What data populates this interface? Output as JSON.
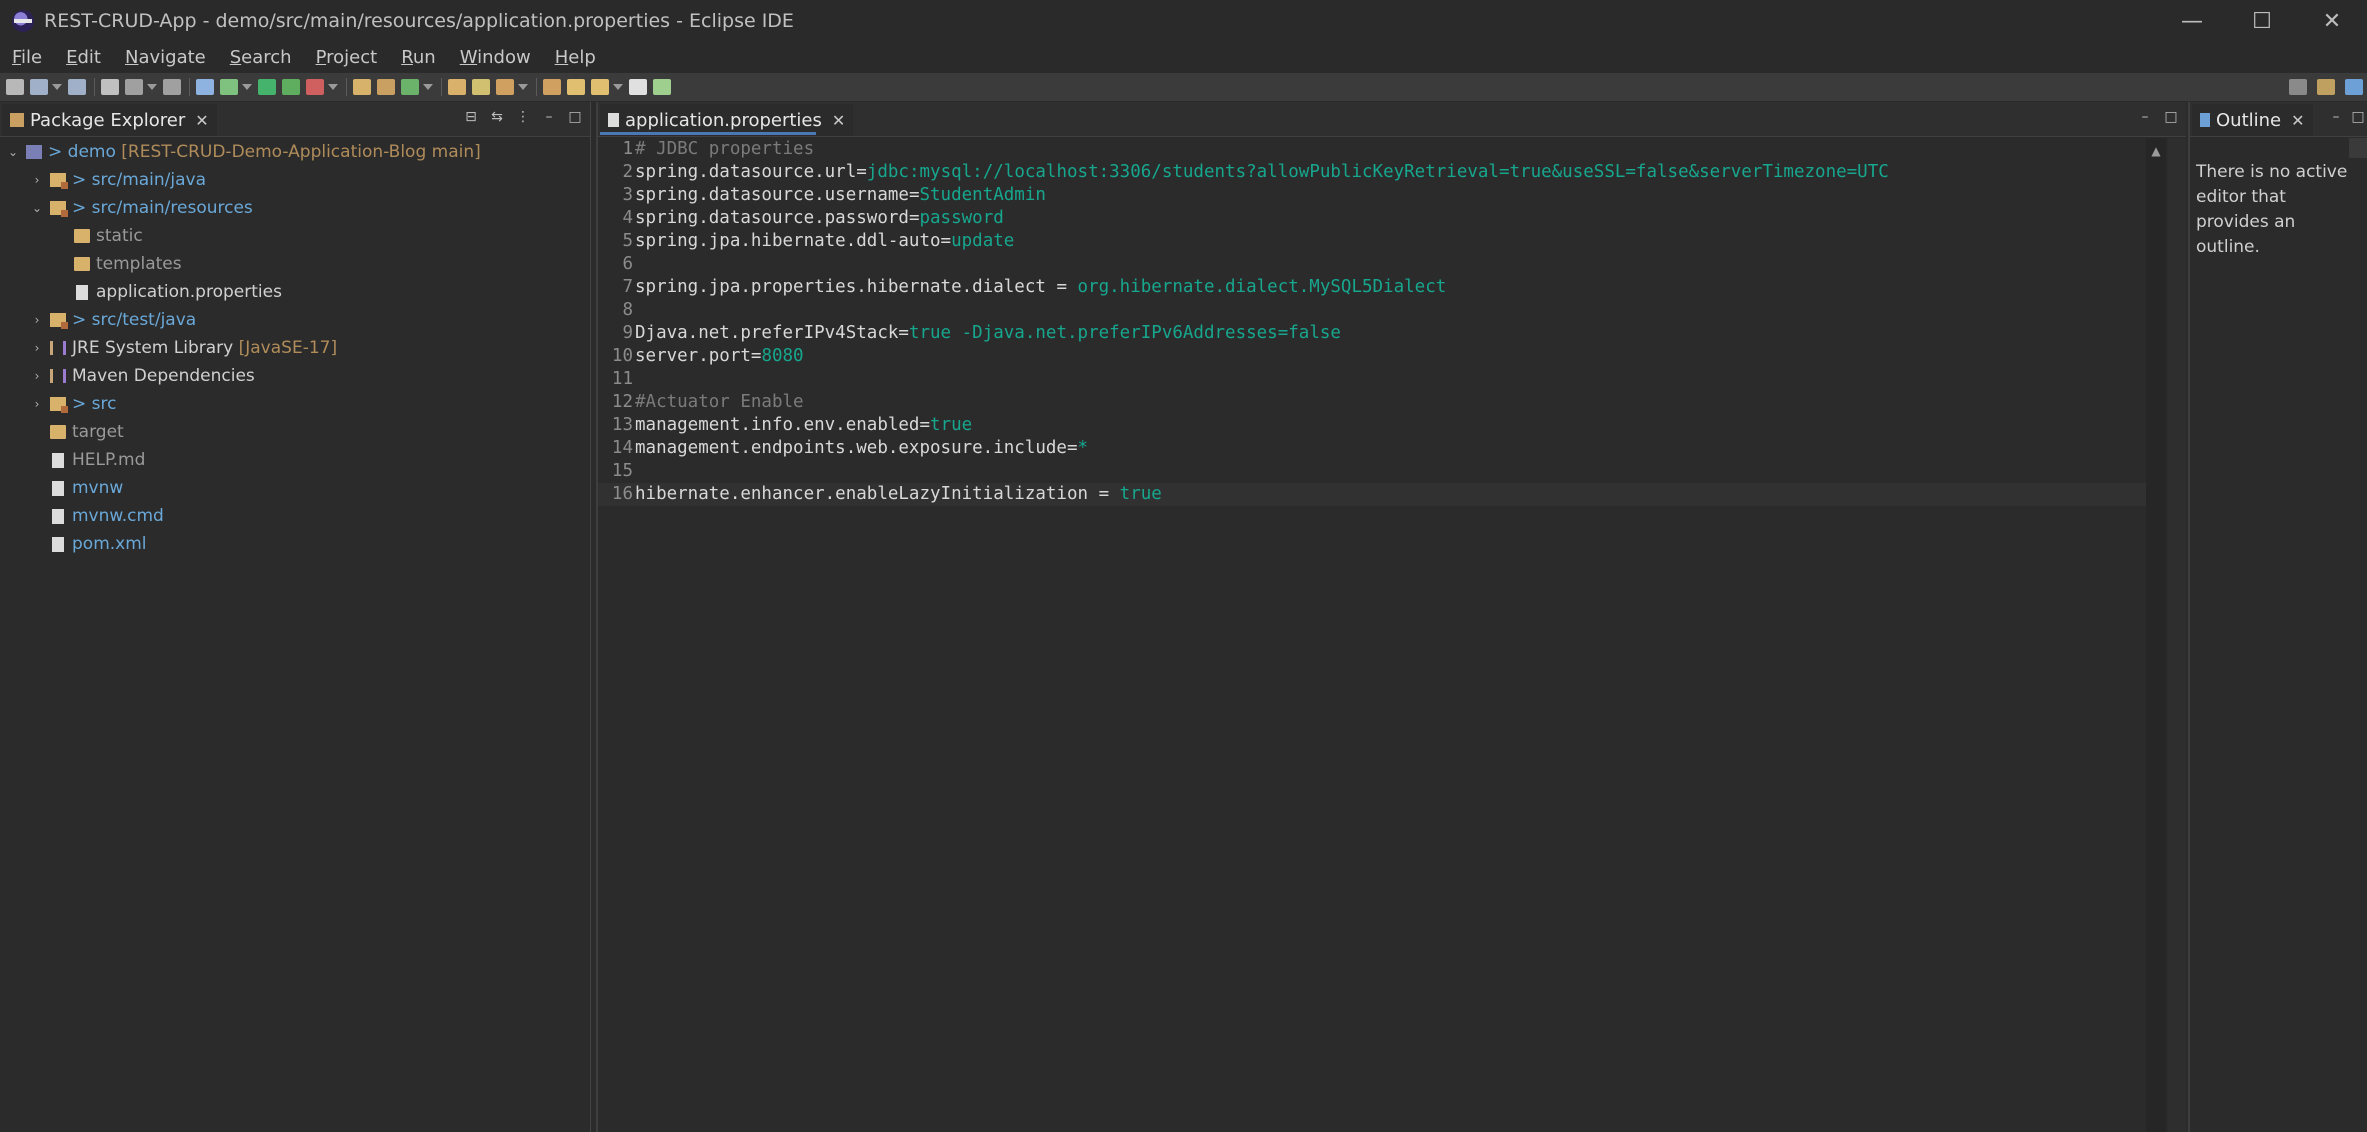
{
  "window": {
    "title": "REST-CRUD-App - demo/src/main/resources/application.properties - Eclipse IDE",
    "controls": {
      "minimize": "—",
      "maximize": "☐",
      "close": "✕"
    }
  },
  "menu": [
    "File",
    "Edit",
    "Navigate",
    "Search",
    "Project",
    "Run",
    "Window",
    "Help"
  ],
  "toolbar": {
    "icons": [
      {
        "name": "new-icon",
        "color": "#b8b8b8"
      },
      {
        "name": "save-icon",
        "color": "#9fb0c8"
      },
      {
        "name": "save-all-icon",
        "color": "#9fb0c8"
      },
      {
        "name": "terminal-icon",
        "color": "#c0c0c0"
      },
      {
        "name": "toggle-block-icon",
        "color": "#a0a0a0"
      },
      {
        "name": "show-whitespace-icon",
        "color": "#a0a0a0"
      },
      {
        "name": "skip-breakpoints-icon",
        "color": "#8fb3e0"
      },
      {
        "name": "debug-icon",
        "color": "#7fc27f"
      },
      {
        "name": "run-icon",
        "color": "#45b36b"
      },
      {
        "name": "coverage-icon",
        "color": "#5fae5f"
      },
      {
        "name": "external-tools-icon",
        "color": "#d06060"
      },
      {
        "name": "new-java-project-icon",
        "color": "#d7b26b"
      },
      {
        "name": "new-package-icon",
        "color": "#c9a062"
      },
      {
        "name": "new-class-icon",
        "color": "#6bb36b"
      },
      {
        "name": "open-type-icon",
        "color": "#d9b16a"
      },
      {
        "name": "search-task-icon",
        "color": "#d0c070"
      },
      {
        "name": "next-annotation-icon",
        "color": "#d0a060"
      },
      {
        "name": "prev-annotation-icon",
        "color": "#d0a060"
      },
      {
        "name": "last-edit-icon",
        "color": "#e0c070"
      },
      {
        "name": "back-icon",
        "color": "#e0c070"
      },
      {
        "name": "forward-icon",
        "color": "#e0e0e0"
      },
      {
        "name": "pin-editor-icon",
        "color": "#9fcf8f"
      }
    ],
    "right_icons": [
      {
        "name": "search-icon",
        "color": "#8a8a8a"
      },
      {
        "name": "open-perspective-icon",
        "color": "#c0a060"
      },
      {
        "name": "java-perspective-icon",
        "color": "#6ea0d8"
      }
    ]
  },
  "package_explorer": {
    "title": "Package Explorer",
    "close": "✕",
    "tree": [
      {
        "indent": 0,
        "arrow": "⌄",
        "icon": "project-icon",
        "prefix": "> ",
        "label": "demo",
        "suffix": " [REST-CRUD-Demo-Application-Blog main]",
        "style": "blue"
      },
      {
        "indent": 1,
        "arrow": "›",
        "icon": "pkgfolder-icon",
        "prefix": "> ",
        "label": "src/main/java",
        "suffix": "",
        "style": "blue"
      },
      {
        "indent": 1,
        "arrow": "⌄",
        "icon": "pkgfolder-icon",
        "prefix": "> ",
        "label": "src/main/resources",
        "suffix": "",
        "style": "blue"
      },
      {
        "indent": 2,
        "arrow": "",
        "icon": "folder-icon",
        "prefix": "",
        "label": "static",
        "suffix": "",
        "style": "gray"
      },
      {
        "indent": 2,
        "arrow": "",
        "icon": "folder-icon",
        "prefix": "",
        "label": "templates",
        "suffix": "",
        "style": "gray"
      },
      {
        "indent": 2,
        "arrow": "",
        "icon": "file-icon",
        "prefix": "",
        "label": "application.properties",
        "suffix": "",
        "style": "white"
      },
      {
        "indent": 1,
        "arrow": "›",
        "icon": "pkgfolder-icon",
        "prefix": "> ",
        "label": "src/test/java",
        "suffix": "",
        "style": "blue"
      },
      {
        "indent": 1,
        "arrow": "›",
        "icon": "lib-icon",
        "prefix": "",
        "label": "JRE System Library",
        "suffix": " [JavaSE-17]",
        "style": "white"
      },
      {
        "indent": 1,
        "arrow": "›",
        "icon": "lib-icon",
        "prefix": "",
        "label": "Maven Dependencies",
        "suffix": "",
        "style": "white"
      },
      {
        "indent": 1,
        "arrow": "›",
        "icon": "pkgfolder-icon",
        "prefix": "> ",
        "label": "src",
        "suffix": "",
        "style": "blue"
      },
      {
        "indent": 1,
        "arrow": "",
        "icon": "folder-icon",
        "prefix": "",
        "label": "target",
        "suffix": "",
        "style": "gray"
      },
      {
        "indent": 1,
        "arrow": "",
        "icon": "file-icon",
        "prefix": "",
        "label": "HELP.md",
        "suffix": "",
        "style": "gray"
      },
      {
        "indent": 1,
        "arrow": "",
        "icon": "file-icon",
        "prefix": "",
        "label": "mvnw",
        "suffix": "",
        "style": "blue"
      },
      {
        "indent": 1,
        "arrow": "",
        "icon": "file-icon",
        "prefix": "",
        "label": "mvnw.cmd",
        "suffix": "",
        "style": "blue"
      },
      {
        "indent": 1,
        "arrow": "",
        "icon": "file-icon",
        "prefix": "",
        "label": "pom.xml",
        "suffix": "",
        "style": "blue"
      }
    ]
  },
  "editor": {
    "tab_label": "application.properties",
    "close": "✕",
    "lines": [
      {
        "n": "1",
        "key": "",
        "sep": "",
        "value": "",
        "comment": "# JDBC properties"
      },
      {
        "n": "2",
        "key": "spring.datasource.url",
        "sep": "=",
        "value": "jdbc:mysql://localhost:3306/students?allowPublicKeyRetrieval=true&useSSL=false&serverTimezone=UTC",
        "comment": ""
      },
      {
        "n": "3",
        "key": "spring.datasource.username",
        "sep": "=",
        "value": "StudentAdmin",
        "comment": ""
      },
      {
        "n": "4",
        "key": "spring.datasource.password",
        "sep": "=",
        "value": "password",
        "comment": ""
      },
      {
        "n": "5",
        "key": "spring.jpa.hibernate.ddl-auto",
        "sep": "=",
        "value": "update",
        "comment": ""
      },
      {
        "n": "6",
        "key": "",
        "sep": "",
        "value": "",
        "comment": ""
      },
      {
        "n": "7",
        "key": "spring.jpa.properties.hibernate.dialect",
        "sep": " = ",
        "value": "org.hibernate.dialect.MySQL5Dialect",
        "comment": ""
      },
      {
        "n": "8",
        "key": "",
        "sep": "",
        "value": "",
        "comment": ""
      },
      {
        "n": "9",
        "key": "Djava.net.preferIPv4Stack",
        "sep": "=",
        "value": "true -Djava.net.preferIPv6Addresses=false",
        "comment": ""
      },
      {
        "n": "10",
        "key": "server.port",
        "sep": "=",
        "value": "8080",
        "comment": ""
      },
      {
        "n": "11",
        "key": "",
        "sep": "",
        "value": "",
        "comment": ""
      },
      {
        "n": "12",
        "key": "",
        "sep": "",
        "value": "",
        "comment": "#Actuator Enable"
      },
      {
        "n": "13",
        "key": "management.info.env.enabled",
        "sep": "=",
        "value": "true",
        "comment": ""
      },
      {
        "n": "14",
        "key": "management.endpoints.web.exposure.include",
        "sep": "=",
        "value": "*",
        "comment": ""
      },
      {
        "n": "15",
        "key": "",
        "sep": "",
        "value": "",
        "comment": ""
      },
      {
        "n": "16",
        "key": "hibernate.enhancer.enableLazyInitialization",
        "sep": " = ",
        "value": "true",
        "comment": ""
      }
    ],
    "current_line": "16"
  },
  "outline": {
    "title": "Outline",
    "close": "✕",
    "message": "There is no active editor that provides an outline."
  },
  "colors": {
    "background": "#2b2b2b",
    "value": "#17a68e",
    "comment": "#7b7b7b",
    "tree_blue": "#6aa8d8",
    "tab_accent": "#4a78b5"
  }
}
